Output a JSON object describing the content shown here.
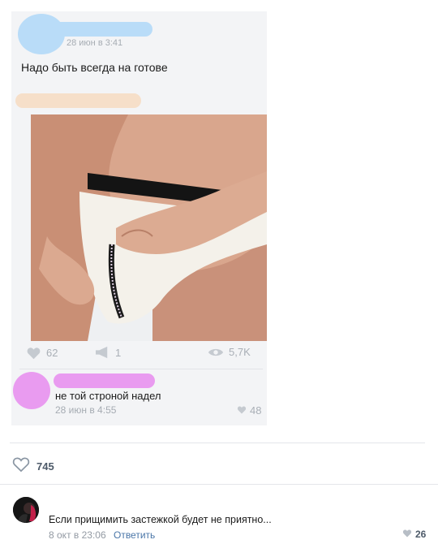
{
  "colors": {
    "accent": "#4a76a8",
    "muted": "#a9afb6",
    "blur_blue": "#b9dcf8",
    "blur_peach": "#f6dfc9",
    "blur_pink": "#e99bf0"
  },
  "embedded_post": {
    "date": "28 июн в 3:41",
    "text": "Надо быть всегда на готове",
    "stats": {
      "likes": "62",
      "reposts": "1",
      "views": "5,7K"
    },
    "comment": {
      "text": "не той строной надел",
      "date": "28 июн в 4:55",
      "likes": "48"
    }
  },
  "post": {
    "likes": "745",
    "like_icon": "heart-outline-icon"
  },
  "comment": {
    "text": "Если прищимить застежкой будет не приятно...",
    "date": "8 окт в 23:06",
    "reply_label": "Ответить",
    "likes": "26"
  }
}
